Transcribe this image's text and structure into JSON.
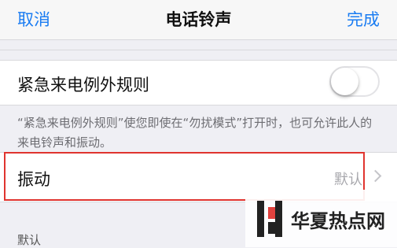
{
  "navbar": {
    "cancel_label": "取消",
    "title": "电话铃声",
    "done_label": "完成"
  },
  "emergency": {
    "label": "紧急来电例外规则",
    "toggle_on": false,
    "footnote": "“紧急来电例外规则”使您即使在“勿扰模式”打开时，也可允许此人的来电铃声和振动。"
  },
  "vibration": {
    "label": "振动",
    "value": "默认"
  },
  "section_header": "默认",
  "watermark": {
    "text": "华夏热点网"
  },
  "colors": {
    "accent": "#1a7cf2",
    "highlight": "#e0342f",
    "background": "#efeff4"
  }
}
